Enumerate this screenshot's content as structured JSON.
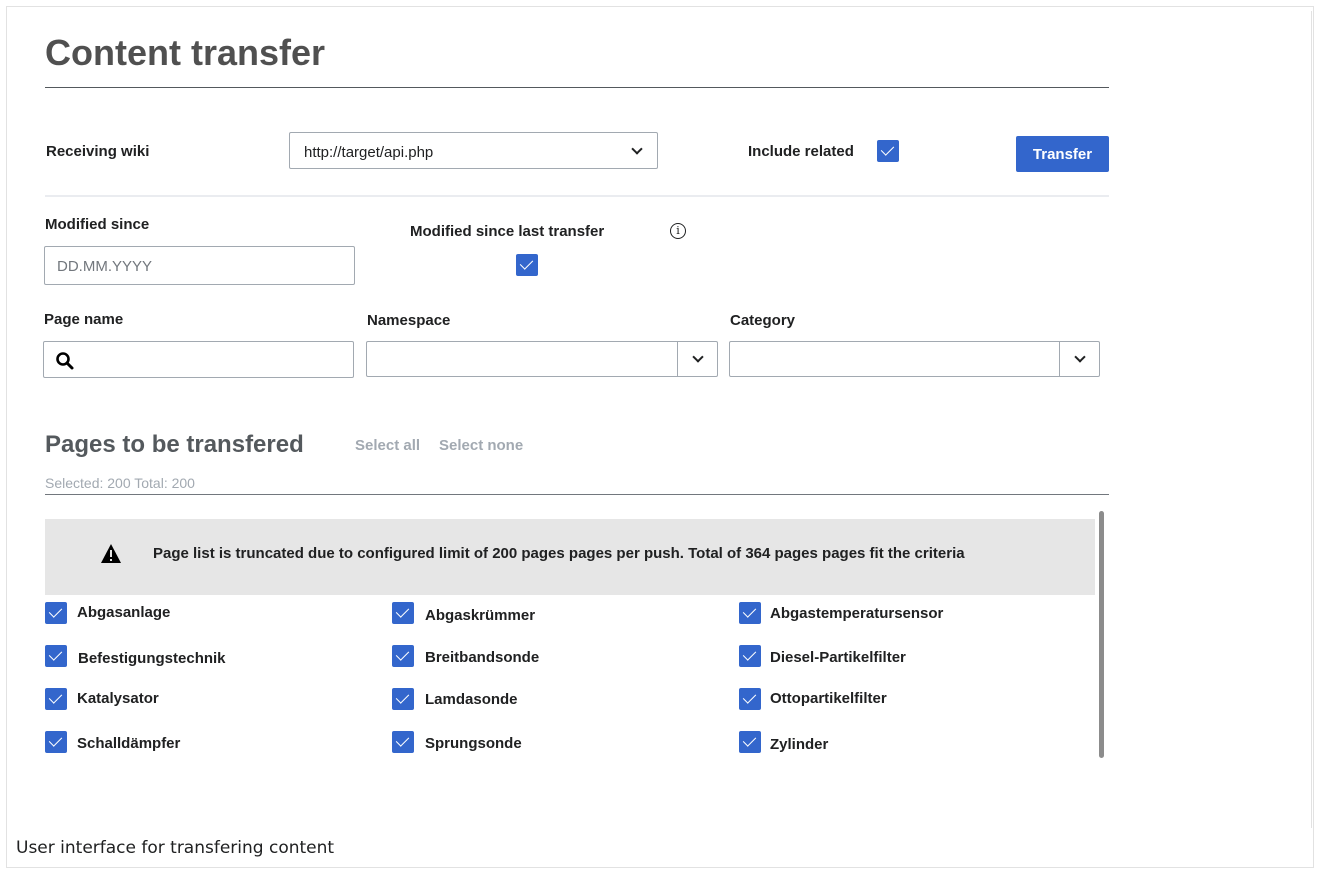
{
  "page": {
    "title": "Content transfer",
    "caption": "User interface for transfering content"
  },
  "receiving": {
    "label": "Receiving wiki",
    "selected": "http://target/api.php",
    "include_related_label": "Include related",
    "include_related_checked": true,
    "transfer_button": "Transfer"
  },
  "filters": {
    "modified_since_label": "Modified since",
    "modified_since_placeholder": "DD.MM.YYYY",
    "modified_last_label": "Modified since last transfer",
    "modified_last_checked": true,
    "page_name_label": "Page name",
    "namespace_label": "Namespace",
    "category_label": "Category"
  },
  "pages": {
    "title": "Pages to be transfered",
    "select_all": "Select all",
    "select_none": "Select none",
    "count_text": "Selected: 200 Total: 200",
    "warning": "Page list is truncated due to configured limit of 200 pages pages per push. Total of 364 pages pages fit the criteria",
    "items": [
      "Abgasanlage",
      "Abgaskrümmer",
      "Abgastemperatursensor",
      "Befestigungstechnik",
      "Breitbandsonde",
      "Diesel-Partikelfilter",
      "Katalysator",
      "Lamdasonde",
      "Ottopartikelfilter",
      "Schalldämpfer",
      "Sprungsonde",
      "Zylinder"
    ]
  },
  "icons": {
    "search": "search-icon",
    "info": "info-icon",
    "warning": "warning-icon",
    "chevron": "chevron-down-icon",
    "checkbox": "checkbox-checked-icon"
  },
  "colors": {
    "accent": "#3366cc",
    "warning_bg": "#e6e6e6",
    "muted": "#a2a9b1"
  }
}
